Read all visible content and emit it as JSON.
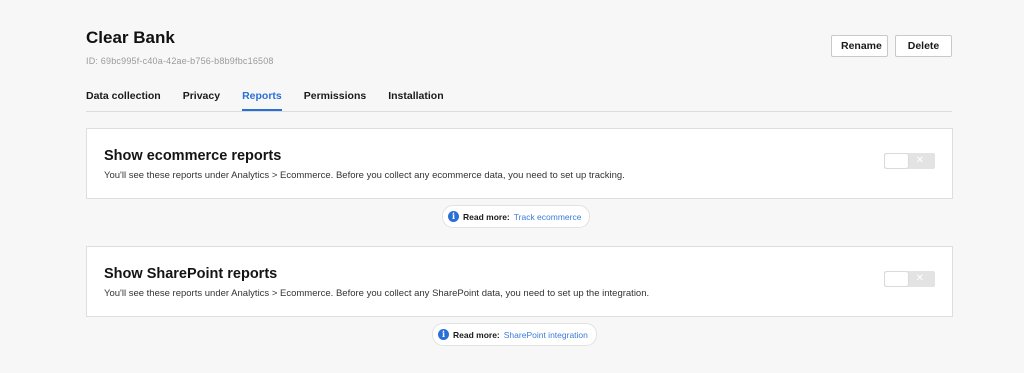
{
  "site": {
    "name": "Clear Bank",
    "id": "ID: 69bc995f-c40a-42ae-b756-b8b9fbc16508"
  },
  "actions": {
    "rename": "Rename",
    "delete": "Delete"
  },
  "tabs": [
    {
      "label": "Data collection",
      "active": false
    },
    {
      "label": "Privacy",
      "active": false
    },
    {
      "label": "Reports",
      "active": true
    },
    {
      "label": "Permissions",
      "active": false
    },
    {
      "label": "Installation",
      "active": false
    }
  ],
  "settings": [
    {
      "title": "Show ecommerce reports",
      "description": "You'll see these reports under Analytics > Ecommerce. Before you collect any ecommerce data, you need to set up tracking.",
      "enabled": false,
      "toggle_off_symbol": "✕",
      "read_more_label": "Read more:",
      "read_more_link": "Track ecommerce"
    },
    {
      "title": "Show SharePoint reports",
      "description": "You'll see these reports under Analytics > Ecommerce. Before you collect any SharePoint data, you need to set up the integration.",
      "enabled": false,
      "toggle_off_symbol": "✕",
      "read_more_label": "Read more:",
      "read_more_link": "SharePoint integration"
    }
  ],
  "icons": {
    "info": "info-icon"
  },
  "colors": {
    "accent": "#2a6fd6",
    "link": "#3b7bd8",
    "toggle_off": "#e3e3e3"
  }
}
